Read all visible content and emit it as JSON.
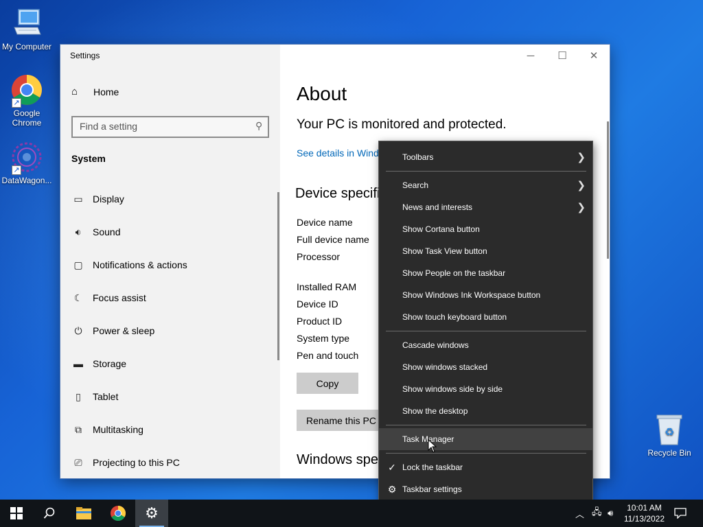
{
  "desktop": {
    "icons": [
      {
        "label": "My Computer"
      },
      {
        "label": "Google Chrome"
      },
      {
        "label": "DataWagon..."
      },
      {
        "label": "Recycle Bin"
      }
    ]
  },
  "settings": {
    "title": "Settings",
    "home": "Home",
    "search_placeholder": "Find a setting",
    "section": "System",
    "nav": [
      {
        "label": "Display",
        "icon": "display-icon"
      },
      {
        "label": "Sound",
        "icon": "sound-icon"
      },
      {
        "label": "Notifications & actions",
        "icon": "notifications-icon"
      },
      {
        "label": "Focus assist",
        "icon": "moon-icon"
      },
      {
        "label": "Power & sleep",
        "icon": "power-icon"
      },
      {
        "label": "Storage",
        "icon": "storage-icon"
      },
      {
        "label": "Tablet",
        "icon": "tablet-icon"
      },
      {
        "label": "Multitasking",
        "icon": "multitasking-icon"
      },
      {
        "label": "Projecting to this PC",
        "icon": "projecting-icon"
      }
    ],
    "about": {
      "heading": "About",
      "status": "Your PC is monitored and protected.",
      "details_link": "See details in Windo",
      "device_spec_heading": "Device specifi",
      "spec_labels": [
        "Device name",
        "Full device name",
        "Processor",
        "Installed RAM",
        "Device ID",
        "Product ID",
        "System type",
        "Pen and touch"
      ],
      "copy_button": "Copy",
      "rename_button": "Rename this PC",
      "windows_spec_heading": "Windows spe"
    }
  },
  "context_menu": {
    "items": [
      {
        "label": "Toolbars",
        "submenu": true
      },
      {
        "label": "Search",
        "submenu": true
      },
      {
        "label": "News and interests",
        "submenu": true
      },
      {
        "label": "Show Cortana button"
      },
      {
        "label": "Show Task View button"
      },
      {
        "label": "Show People on the taskbar"
      },
      {
        "label": "Show Windows Ink Workspace button"
      },
      {
        "label": "Show touch keyboard button"
      },
      {
        "label": "Cascade windows"
      },
      {
        "label": "Show windows stacked"
      },
      {
        "label": "Show windows side by side"
      },
      {
        "label": "Show the desktop"
      },
      {
        "label": "Task Manager",
        "highlighted": true
      },
      {
        "label": "Lock the taskbar",
        "checked": true
      },
      {
        "label": "Taskbar settings",
        "icon": "gear-icon"
      }
    ]
  },
  "taskbar": {
    "time": "10:01 AM",
    "date": "11/13/2022"
  }
}
